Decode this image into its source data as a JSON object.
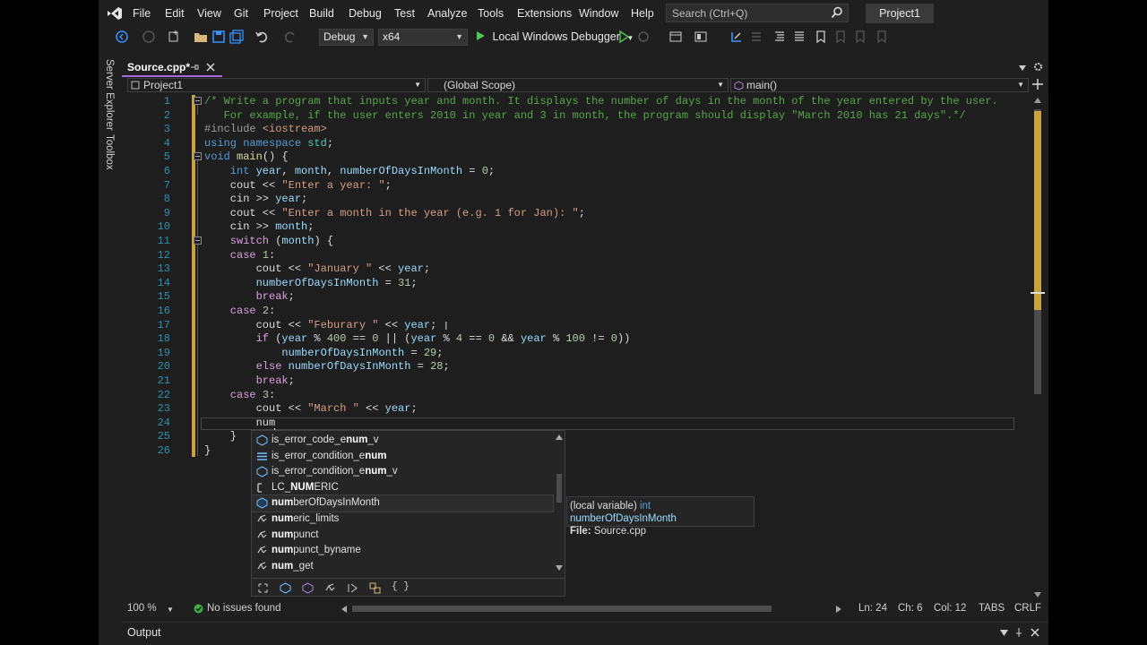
{
  "menu": [
    "File",
    "Edit",
    "View",
    "Git",
    "Project",
    "Build",
    "Debug",
    "Test",
    "Analyze",
    "Tools",
    "Extensions",
    "Window",
    "Help"
  ],
  "search": {
    "placeholder": "Search (Ctrl+Q)"
  },
  "project_badge": "Project1",
  "toolbar": {
    "config": "Debug",
    "platform": "x64",
    "run_label": "Local Windows Debugger"
  },
  "side": {
    "server_explorer": "Server Explorer",
    "toolbox": "Toolbox"
  },
  "tab": {
    "label": "Source.cpp*"
  },
  "nav": {
    "project": "Project1",
    "scope": "(Global Scope)",
    "member": "main()"
  },
  "code_lines": [
    "1",
    "2",
    "3",
    "4",
    "5",
    "6",
    "7",
    "8",
    "9",
    "10",
    "11",
    "12",
    "13",
    "14",
    "15",
    "16",
    "17",
    "18",
    "19",
    "20",
    "21",
    "22",
    "23",
    "24",
    "25",
    "26"
  ],
  "code_text": {
    "l1": "/* Write a program that inputs year and month. It displays the number of days in the month of the year entered by the user.",
    "l2": "   For example, if the user enters 2010 in year and 3 in month, the program should display \"March 2010 has 21 days\".*/",
    "l3a": "#include ",
    "l3b": "<iostream>",
    "l4a": "using namespace ",
    "l4b": "std",
    "l4c": ";",
    "l5a": "void ",
    "l5b": "main",
    "l5c": "() {",
    "l6a": "    int ",
    "l6b": "year",
    "l6c": ", ",
    "l6d": "month",
    "l6e": ", ",
    "l6f": "numberOfDaysInMonth",
    "l6g": " = ",
    "l6h": "0",
    "l6i": ";",
    "l7a": "    cout << ",
    "l7b": "\"Enter a year: \"",
    "l7c": ";",
    "l8a": "    cin >> ",
    "l8b": "year",
    "l8c": ";",
    "l9a": "    cout << ",
    "l9b": "\"Enter a month in the year (e.g. 1 for Jan): \"",
    "l9c": ";",
    "l10a": "    cin >> ",
    "l10b": "month",
    "l10c": ";",
    "l11a": "    switch",
    "l11b": " (",
    "l11c": "month",
    "l11d": ") {",
    "l12a": "    case ",
    "l12b": "1",
    "l12c": ":",
    "l13a": "        cout << ",
    "l13b": "\"January \"",
    "l13c": " << ",
    "l13d": "year",
    "l13e": ";",
    "l14a": "        ",
    "l14b": "numberOfDaysInMonth",
    "l14c": " = ",
    "l14d": "31",
    "l14e": ";",
    "l15a": "        ",
    "l15b": "break",
    "l15c": ";",
    "l16a": "    case ",
    "l16b": "2",
    "l16c": ":",
    "l17a": "        cout << ",
    "l17b": "\"Feburary \"",
    "l17c": " << ",
    "l17d": "year",
    "l17e": ";",
    "l18a": "        ",
    "l18b": "if",
    "l18c": " (",
    "l18d": "year",
    "l18e": " % ",
    "l18f": "400",
    "l18g": " == ",
    "l18h": "0",
    "l18i": " || (",
    "l18j": "year",
    "l18k": " % ",
    "l18l": "4",
    "l18m": " == ",
    "l18n": "0",
    "l18o": " && ",
    "l18p": "year",
    "l18q": " % ",
    "l18r": "100",
    "l18s": " != ",
    "l18t": "0",
    "l18u": "))",
    "l19a": "            ",
    "l19b": "numberOfDaysInMonth",
    "l19c": " = ",
    "l19d": "29",
    "l19e": ";",
    "l20a": "        ",
    "l20b": "else",
    "l20c": " ",
    "l20d": "numberOfDaysInMonth",
    "l20e": " = ",
    "l20f": "28",
    "l20g": ";",
    "l21a": "        ",
    "l21b": "break",
    "l21c": ";",
    "l22a": "    case ",
    "l22b": "3",
    "l22c": ":",
    "l23a": "        cout << ",
    "l23b": "\"March \"",
    "l23c": " << ",
    "l23d": "year",
    "l23e": ";",
    "l24": "        num",
    "l25": "    }",
    "l26": "}"
  },
  "completion": [
    {
      "pre": "is_error_code_e",
      "bold": "num",
      "post": "_v",
      "icon": "struct-icon"
    },
    {
      "pre": "is_error_condition_e",
      "bold": "num",
      "post": "",
      "icon": "typedef-icon"
    },
    {
      "pre": "is_error_condition_e",
      "bold": "num",
      "post": "_v",
      "icon": "struct-icon"
    },
    {
      "pre": "LC_",
      "bold": "NUM",
      "post": "ERIC",
      "icon": "macro-icon"
    },
    {
      "pre": "",
      "bold": "num",
      "post": "berOfDaysInMonth",
      "icon": "variable-icon"
    },
    {
      "pre": "",
      "bold": "num",
      "post": "eric_limits",
      "icon": "class-template-icon"
    },
    {
      "pre": "",
      "bold": "num",
      "post": "punct",
      "icon": "class-template-icon"
    },
    {
      "pre": "",
      "bold": "num",
      "post": "punct_byname",
      "icon": "class-template-icon"
    },
    {
      "pre": "",
      "bold": "num",
      "post": "_get",
      "icon": "class-template-icon"
    }
  ],
  "tooltip": {
    "kind": "(local variable)",
    "type": "int",
    "name": "numberOfDaysInMonth",
    "file_label": "File:",
    "file": "Source.cpp"
  },
  "status": {
    "zoom": "100 %",
    "issues": "No issues found",
    "ln": "Ln: 24",
    "ch": "Ch: 6",
    "col": "Col: 12",
    "tabs": "TABS",
    "eol": "CRLF"
  },
  "output": {
    "label": "Output"
  },
  "colors": {
    "accent": "#a66bd8",
    "change_bar": "#c8a23a",
    "line_number": "#2b91af"
  }
}
